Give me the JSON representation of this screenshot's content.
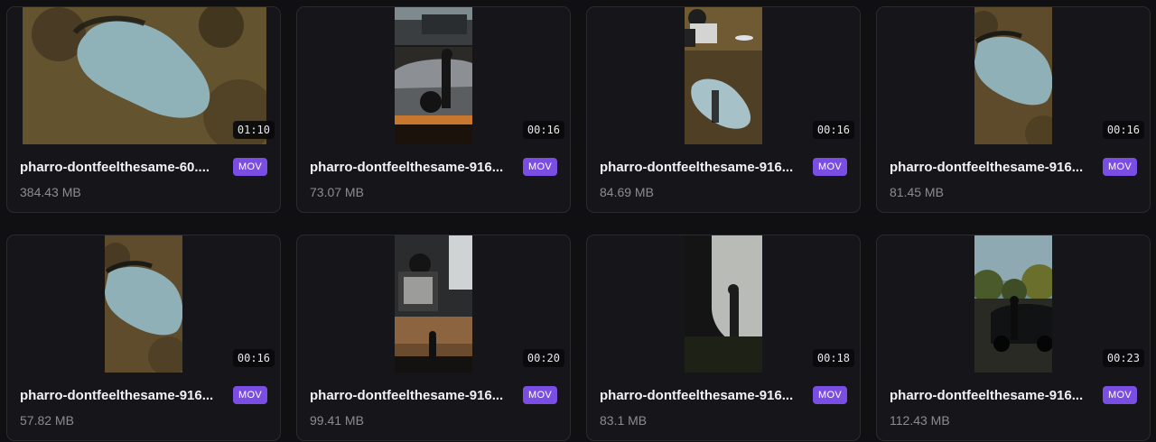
{
  "files": [
    {
      "name": "pharro-dontfeelthesame-60.mov",
      "display_name": "pharro-dontfeelthesame-60....",
      "type": "MOV",
      "size": "384.43 MB",
      "duration": "01:10"
    },
    {
      "name": "pharro-dontfeelthesame-916",
      "display_name": "pharro-dontfeelthesame-916...",
      "type": "MOV",
      "size": "73.07 MB",
      "duration": "00:16"
    },
    {
      "name": "pharro-dontfeelthesame-916",
      "display_name": "pharro-dontfeelthesame-916...",
      "type": "MOV",
      "size": "84.69 MB",
      "duration": "00:16"
    },
    {
      "name": "pharro-dontfeelthesame-916",
      "display_name": "pharro-dontfeelthesame-916...",
      "type": "MOV",
      "size": "81.45 MB",
      "duration": "00:16"
    },
    {
      "name": "pharro-dontfeelthesame-916",
      "display_name": "pharro-dontfeelthesame-916...",
      "type": "MOV",
      "size": "57.82 MB",
      "duration": "00:16"
    },
    {
      "name": "pharro-dontfeelthesame-916",
      "display_name": "pharro-dontfeelthesame-916...",
      "type": "MOV",
      "size": "99.41 MB",
      "duration": "00:20"
    },
    {
      "name": "pharro-dontfeelthesame-916",
      "display_name": "pharro-dontfeelthesame-916...",
      "type": "MOV",
      "size": "83.1 MB",
      "duration": "00:18"
    },
    {
      "name": "pharro-dontfeelthesame-916",
      "display_name": "pharro-dontfeelthesame-916...",
      "type": "MOV",
      "size": "112.43 MB",
      "duration": "00:23"
    }
  ],
  "colors": {
    "background": "#101013",
    "card": "#16161a",
    "badge": "#7b4ee3"
  }
}
